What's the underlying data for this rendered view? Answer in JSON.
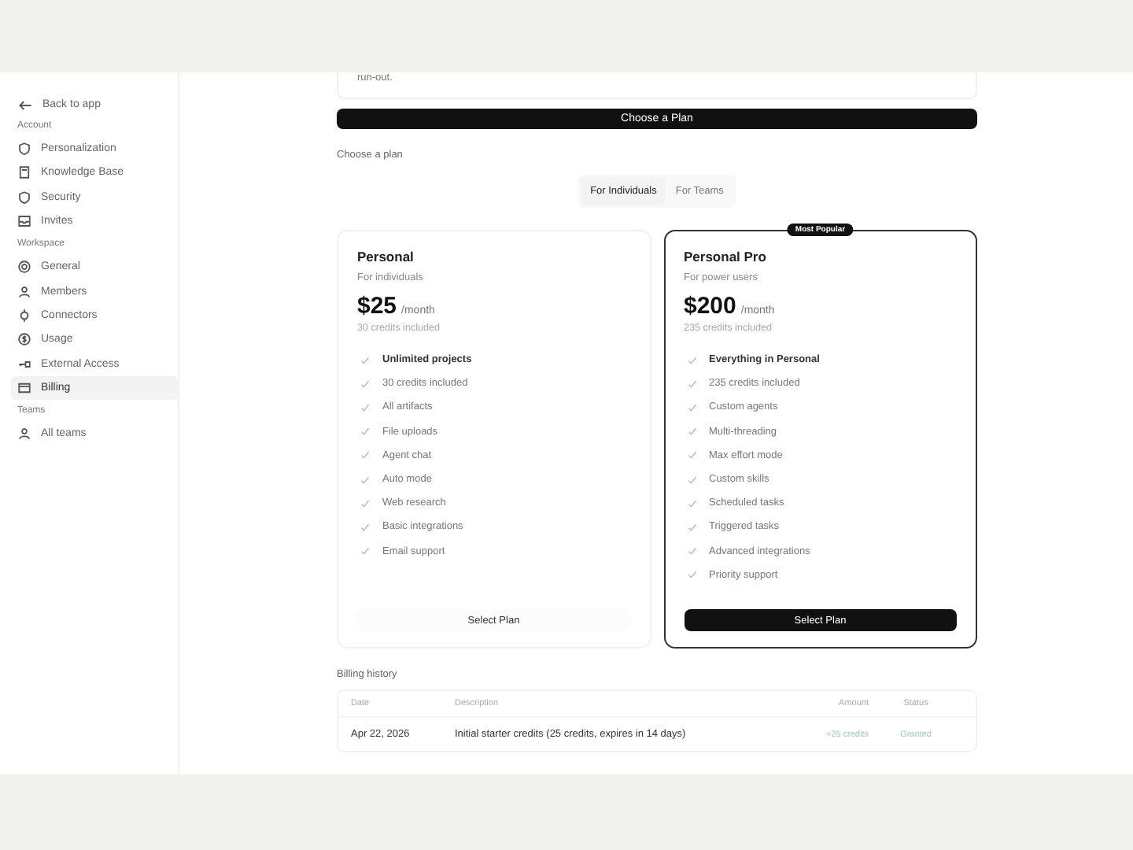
{
  "sidebar": {
    "back": "Back to app",
    "sections": [
      {
        "title": "Account",
        "items": [
          {
            "label": "Personalization",
            "selected": false
          },
          {
            "label": "Knowledge Base",
            "selected": false
          },
          {
            "label": "Security",
            "selected": false
          },
          {
            "label": "Invites",
            "selected": false
          }
        ]
      },
      {
        "title": "Workspace",
        "items": [
          {
            "label": "General",
            "selected": false
          },
          {
            "label": "Members",
            "selected": false
          },
          {
            "label": "Connectors",
            "selected": false
          },
          {
            "label": "Usage",
            "selected": false
          },
          {
            "label": "External Access",
            "selected": false
          },
          {
            "label": "Billing",
            "selected": true
          }
        ]
      },
      {
        "title": "Teams",
        "items": [
          {
            "label": "All teams",
            "selected": false
          }
        ]
      }
    ]
  },
  "top_card": {
    "text": "run-out."
  },
  "choose_button": "Choose a Plan",
  "plan_heading": "Choose a plan",
  "tabs": [
    {
      "label": "For Individuals",
      "selected": true
    },
    {
      "label": "For Teams",
      "selected": false
    }
  ],
  "plans": [
    {
      "name": "Personal",
      "subtitle": "For individuals",
      "price": "$25",
      "period": "/month",
      "credits": "30 credits included",
      "featured": false,
      "features": [
        {
          "text": "Unlimited projects",
          "bold": true
        },
        {
          "text": "30 credits included",
          "bold": false
        },
        {
          "text": "All artifacts",
          "bold": false
        },
        {
          "text": "File uploads",
          "bold": false
        },
        {
          "text": "Agent chat",
          "bold": false
        },
        {
          "text": "Auto mode",
          "bold": false
        },
        {
          "text": "Web research",
          "bold": false
        },
        {
          "text": "Basic integrations",
          "bold": false
        },
        {
          "text": "Email support",
          "bold": false
        }
      ],
      "button": "Select Plan"
    },
    {
      "name": "Personal Pro",
      "badge": "Most Popular",
      "subtitle": "For power users",
      "price": "$200",
      "period": "/month",
      "credits": "235 credits included",
      "featured": true,
      "features": [
        {
          "text": "Everything in Personal",
          "bold": true
        },
        {
          "text": "235 credits included",
          "bold": false
        },
        {
          "text": "Custom agents",
          "bold": false
        },
        {
          "text": "Multi-threading",
          "bold": false
        },
        {
          "text": "Max effort mode",
          "bold": false
        },
        {
          "text": "Custom skills",
          "bold": false
        },
        {
          "text": "Scheduled tasks",
          "bold": false
        },
        {
          "text": "Triggered tasks",
          "bold": false
        },
        {
          "text": "Advanced integrations",
          "bold": false
        },
        {
          "text": "Priority support",
          "bold": false
        }
      ],
      "button": "Select Plan"
    }
  ],
  "billing_history": {
    "title": "Billing history",
    "columns": [
      "Date",
      "Description",
      "Amount",
      "Status"
    ],
    "rows": [
      {
        "date": "Apr 22, 2026",
        "description": "Initial starter credits (25 credits, expires in 14 days)",
        "amount": "+25 credits",
        "status": "Granted"
      }
    ]
  }
}
